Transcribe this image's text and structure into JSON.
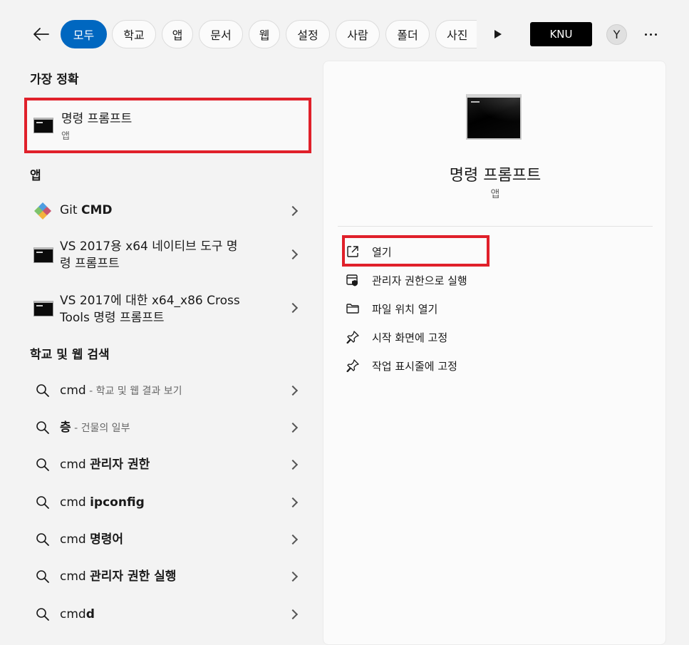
{
  "top": {
    "chips": [
      "모두",
      "학교",
      "앱",
      "문서",
      "웹",
      "설정",
      "사람",
      "폴더",
      "사진"
    ],
    "org_label": "KNU",
    "avatar_initial": "Y"
  },
  "sections": {
    "best_match": "가장 정확",
    "apps": "앱",
    "web": "학교 및 웹 검색"
  },
  "best_match": {
    "title": "명령 프롬프트",
    "subtitle": "앱"
  },
  "apps": [
    {
      "prefix": "Git ",
      "bold": "CMD",
      "line2": ""
    },
    {
      "prefix": "VS 2017용 x64 네이티브 도구 명",
      "bold": "",
      "line2": "령 프롬프트"
    },
    {
      "prefix": "VS 2017에 대한 x64_x86 Cross",
      "bold": "",
      "line2": "Tools 명령 프롬프트"
    }
  ],
  "web_results": [
    {
      "prefix": "cmd",
      "bold": "",
      "muted": " - 학교 및 웹 결과 보기"
    },
    {
      "prefix": "",
      "bold": "층",
      "muted": " - 건물의 일부"
    },
    {
      "prefix": "cmd ",
      "bold": "관리자 권한",
      "muted": ""
    },
    {
      "prefix": "cmd ",
      "bold": "ipconfig",
      "muted": ""
    },
    {
      "prefix": "cmd ",
      "bold": "명령어",
      "muted": ""
    },
    {
      "prefix": "cmd ",
      "bold": "관리자 권한 실행",
      "muted": ""
    },
    {
      "prefix": "cmd",
      "bold": "d",
      "muted": ""
    }
  ],
  "detail": {
    "title": "명령 프롬프트",
    "subtitle": "앱",
    "actions": [
      {
        "label": "열기",
        "icon": "open-external-icon"
      },
      {
        "label": "관리자 권한으로 실행",
        "icon": "admin-shield-icon"
      },
      {
        "label": "파일 위치 열기",
        "icon": "folder-icon"
      },
      {
        "label": "시작 화면에 고정",
        "icon": "pin-icon"
      },
      {
        "label": "작업 표시줄에 고정",
        "icon": "pin-icon"
      }
    ]
  },
  "colors": {
    "accent": "#0067c0",
    "highlight_box": "#e0202a",
    "panel_bg": "#fbfbfb",
    "window_bg": "#f3f3f3"
  }
}
